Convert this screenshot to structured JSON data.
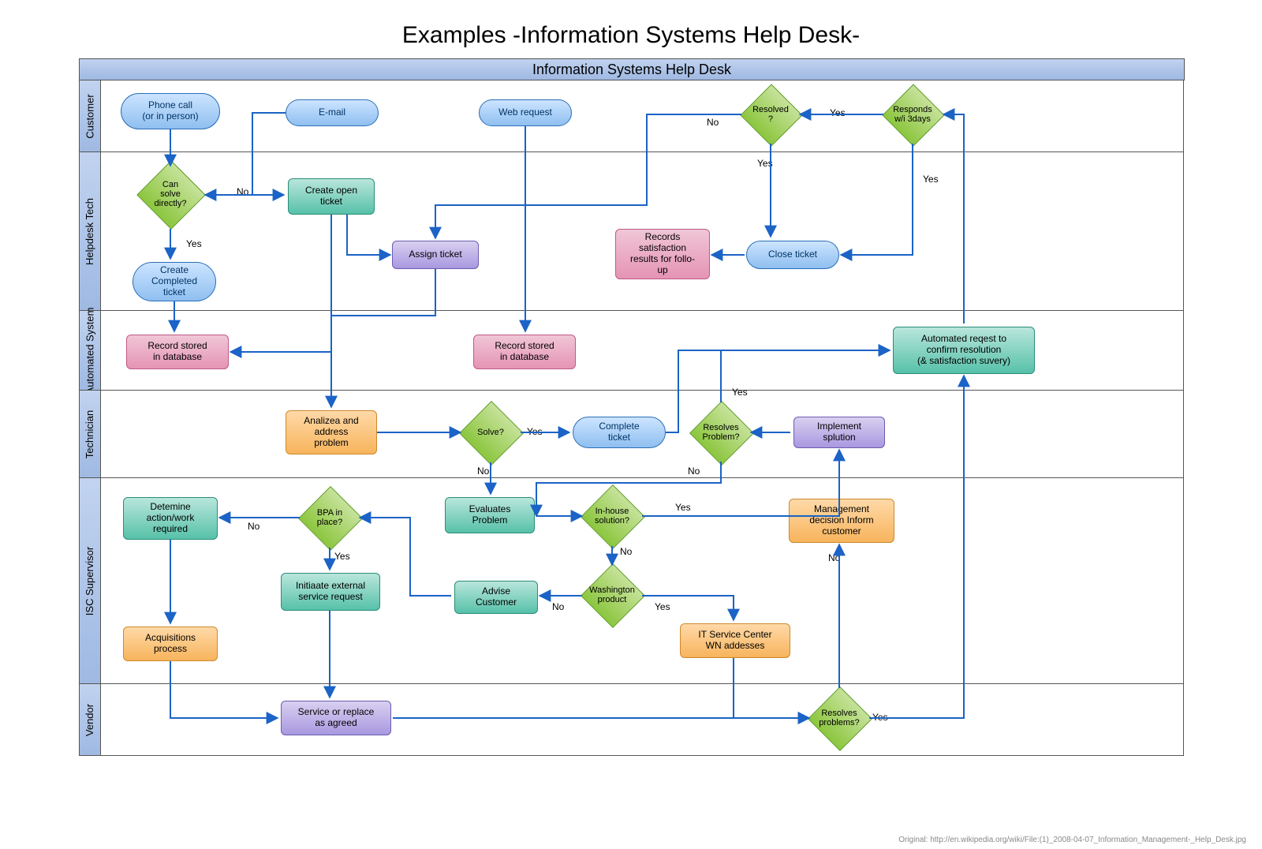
{
  "page_title": "Examples -Information Systems Help Desk-",
  "header": "Information Systems Help Desk",
  "credit": "Original: http://en.wikipedia.org/wiki/File:(1)_2008-04-07_Information_Management-_Help_Desk.jpg",
  "lanes": {
    "customer": "Customer",
    "helpdesk": "Helpdesk Tech",
    "auto": "Automated System",
    "tech": "Technician",
    "supervisor": "ISC Supervisor",
    "vendor": "Vendor"
  },
  "nodes": {
    "phone": "Phone call\n(or in person)",
    "email": "E-mail",
    "web": "Web request",
    "resolved": "Resolved\n?",
    "responds": "Responds\nw/i 3days",
    "cansolve": "Can\nsolve\ndirectly?",
    "createopen": "Create open\nticket",
    "assign": "Assign ticket",
    "createcompleted": "Create\nCompleted\nticket",
    "closeticket": "Close ticket",
    "recordsat": "Records\nsatisfaction\nresults for follo-\nup",
    "recstore1": "Record stored\nin database",
    "recstore2": "Record stored\nin database",
    "autoreq": "Automated reqest to\nconfirm resolution\n(& satisfaction suvery)",
    "analize": "Analizea and\naddress\nproblem",
    "solve": "Solve?",
    "completeticket": "Complete\nticket",
    "resolvesprob": "Resolves\nProblem?",
    "implement": "Implement\nsplution",
    "determine": "Detemine\naction/work\nrequired",
    "bpa": "BPA in\nplace?",
    "evaluates": "Evaluates\nProblem",
    "inhouse": "In-house\nsolution?",
    "mgmt": "Management\ndecision Inform\ncustomer",
    "initiate": "Initiaate external\nservice request",
    "advise": "Advise\nCustomer",
    "washington": "Washington\nproduct",
    "itservice": "IT Service Center\nWN addesses",
    "acquisitions": "Acquisitions\nprocess",
    "serviceagreed": "Service or replace\nas agreed",
    "resolvesprob2": "Resolves\nproblems?"
  },
  "labels": {
    "yes": "Yes",
    "no": "No"
  }
}
